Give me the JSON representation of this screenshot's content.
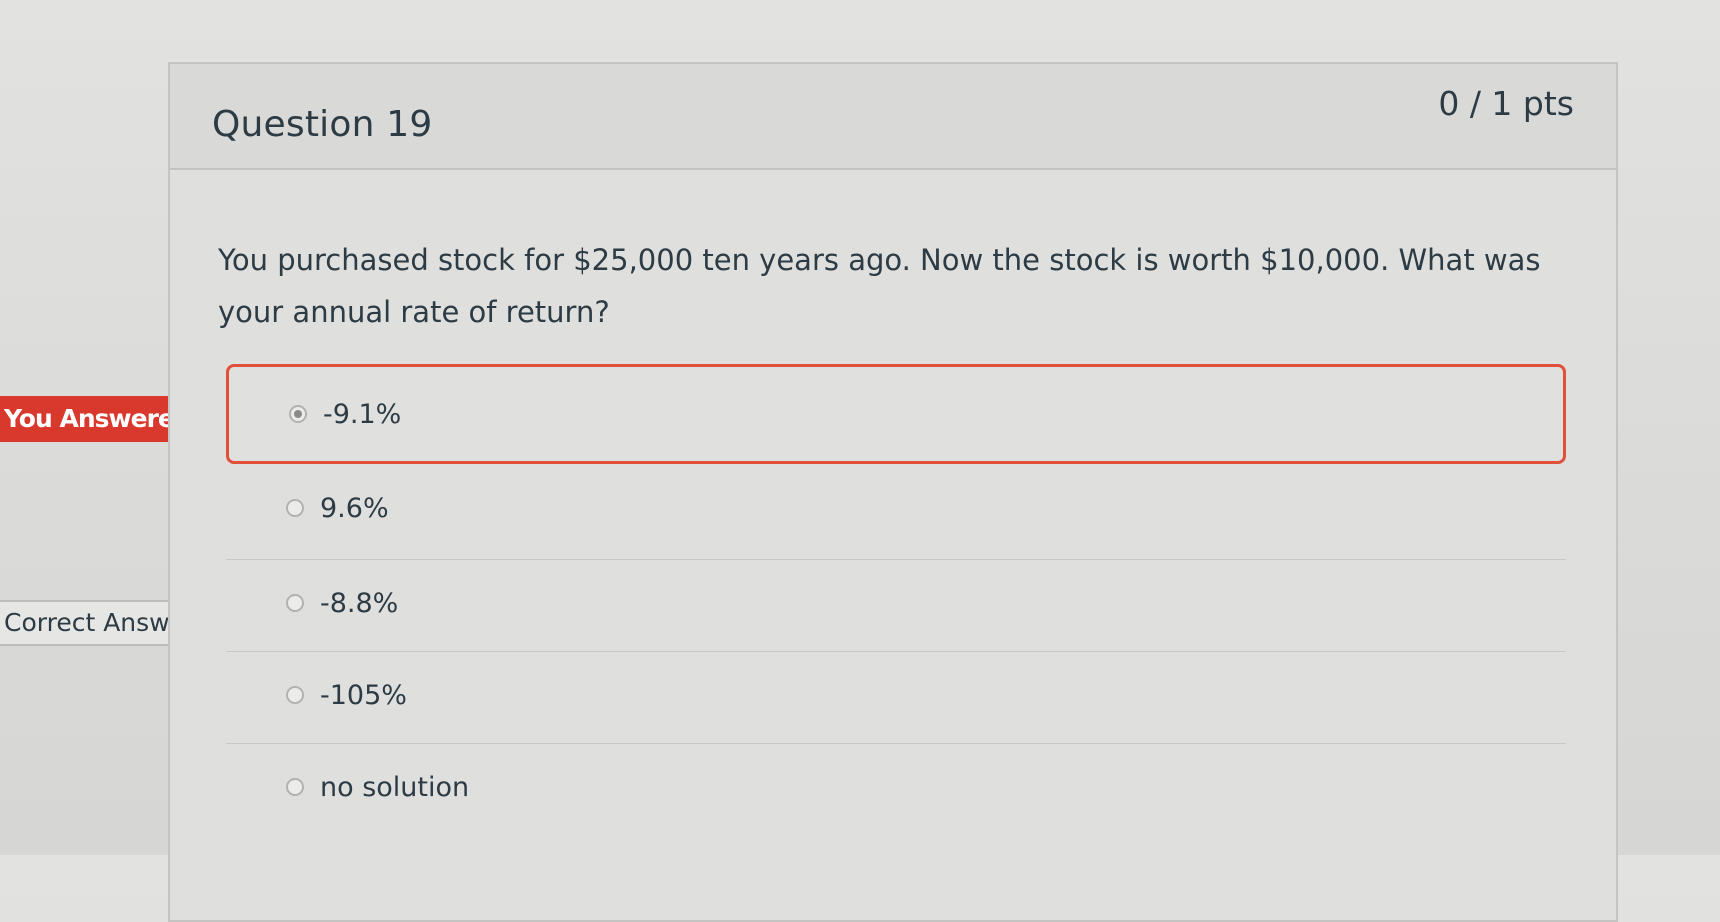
{
  "question": {
    "title": "Question 19",
    "points": "0 / 1 pts",
    "text": "You purchased stock for $25,000 ten years ago.  Now the stock is worth $10,000.  What was your annual rate of return?"
  },
  "flags": {
    "you_answered": "You Answered",
    "correct_answer": "Correct Answer"
  },
  "answers": [
    {
      "label": "-9.1%",
      "selected": true,
      "status": "incorrect"
    },
    {
      "label": "9.6%",
      "selected": false
    },
    {
      "label": "-8.8%",
      "selected": false,
      "status": "correct"
    },
    {
      "label": "-105%",
      "selected": false
    },
    {
      "label": "no solution",
      "selected": false
    }
  ],
  "colors": {
    "wrong_accent": "#d9382c",
    "text": "#2d3b45",
    "background": "#dcdcda"
  }
}
